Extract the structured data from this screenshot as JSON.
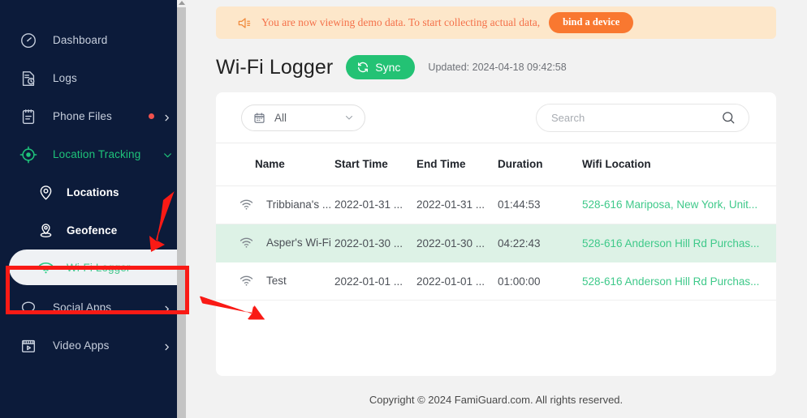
{
  "sidebar": {
    "items": [
      {
        "label": "Dashboard",
        "icon": "gauge-icon",
        "accent": false,
        "dot": false,
        "chevron": ""
      },
      {
        "label": "Logs",
        "icon": "log-file-icon",
        "accent": false,
        "dot": false,
        "chevron": ""
      },
      {
        "label": "Phone Files",
        "icon": "clipboard-icon",
        "accent": false,
        "dot": true,
        "chevron": "right"
      },
      {
        "label": "Location Tracking",
        "icon": "target-icon",
        "accent": true,
        "dot": false,
        "chevron": "down"
      }
    ],
    "subitems": [
      {
        "label": "Locations",
        "icon": "map-pin-icon",
        "active": false
      },
      {
        "label": "Geofence",
        "icon": "geofence-icon",
        "active": false
      },
      {
        "label": "Wi-Fi Logger",
        "icon": "wifi-icon",
        "active": true
      }
    ],
    "items_after": [
      {
        "label": "Social Apps",
        "icon": "chat-bubble-icon",
        "accent": false,
        "dot": false,
        "chevron": "right"
      },
      {
        "label": "Video Apps",
        "icon": "video-icon",
        "accent": false,
        "dot": false,
        "chevron": "right"
      }
    ]
  },
  "banner": {
    "icon": "megaphone-icon",
    "text": "You are now viewing demo data. To start collecting actual data,",
    "button_label": "bind a device"
  },
  "header": {
    "title": "Wi-Fi Logger",
    "sync_label": "Sync",
    "sync_icon": "refresh-icon",
    "updated": "Updated: 2024-04-18 09:42:58"
  },
  "toolbar": {
    "filter_icon": "calendar-icon",
    "filter_value": "All",
    "filter_chevron": "chevron-down-icon",
    "search_placeholder": "Search",
    "search_value": "",
    "search_icon": "search-icon"
  },
  "table": {
    "columns": [
      "Name",
      "Start Time",
      "End Time",
      "Duration",
      "Wifi Location"
    ],
    "rows": [
      {
        "name": "Tribbiana's ...",
        "start": "2022-01-31 ...",
        "end": "2022-01-31 ...",
        "duration": "01:44:53",
        "location": "528-616 Mariposa, New York, Unit...",
        "highlight": false
      },
      {
        "name": "Asper's Wi-Fi",
        "start": "2022-01-30 ...",
        "end": "2022-01-30 ...",
        "duration": "04:22:43",
        "location": "528-616 Anderson Hill Rd Purchas...",
        "highlight": true
      },
      {
        "name": "Test",
        "start": "2022-01-01 ...",
        "end": "2022-01-01 ...",
        "duration": "01:00:00",
        "location": "528-616 Anderson Hill Rd Purchas...",
        "highlight": false
      }
    ]
  },
  "footer": {
    "text": "Copyright © 2024 FamiGuard.com. All rights reserved."
  },
  "colors": {
    "sidebar_bg": "#0c1b3a",
    "accent_green": "#1ec37a",
    "link_green": "#3fc98a",
    "banner_bg": "#fde7ca",
    "banner_text": "#f4714a",
    "bind_button": "#f97830",
    "sync_button": "#23c274",
    "row_highlight": "#ddf2e6",
    "annotation_red": "#f91a15"
  },
  "annotations": {
    "highlight_box_target": "Wi-Fi Logger",
    "arrow_1": "points to Wi-Fi Logger menu item",
    "arrow_2": "points to Wi-Fi Logger table content"
  }
}
